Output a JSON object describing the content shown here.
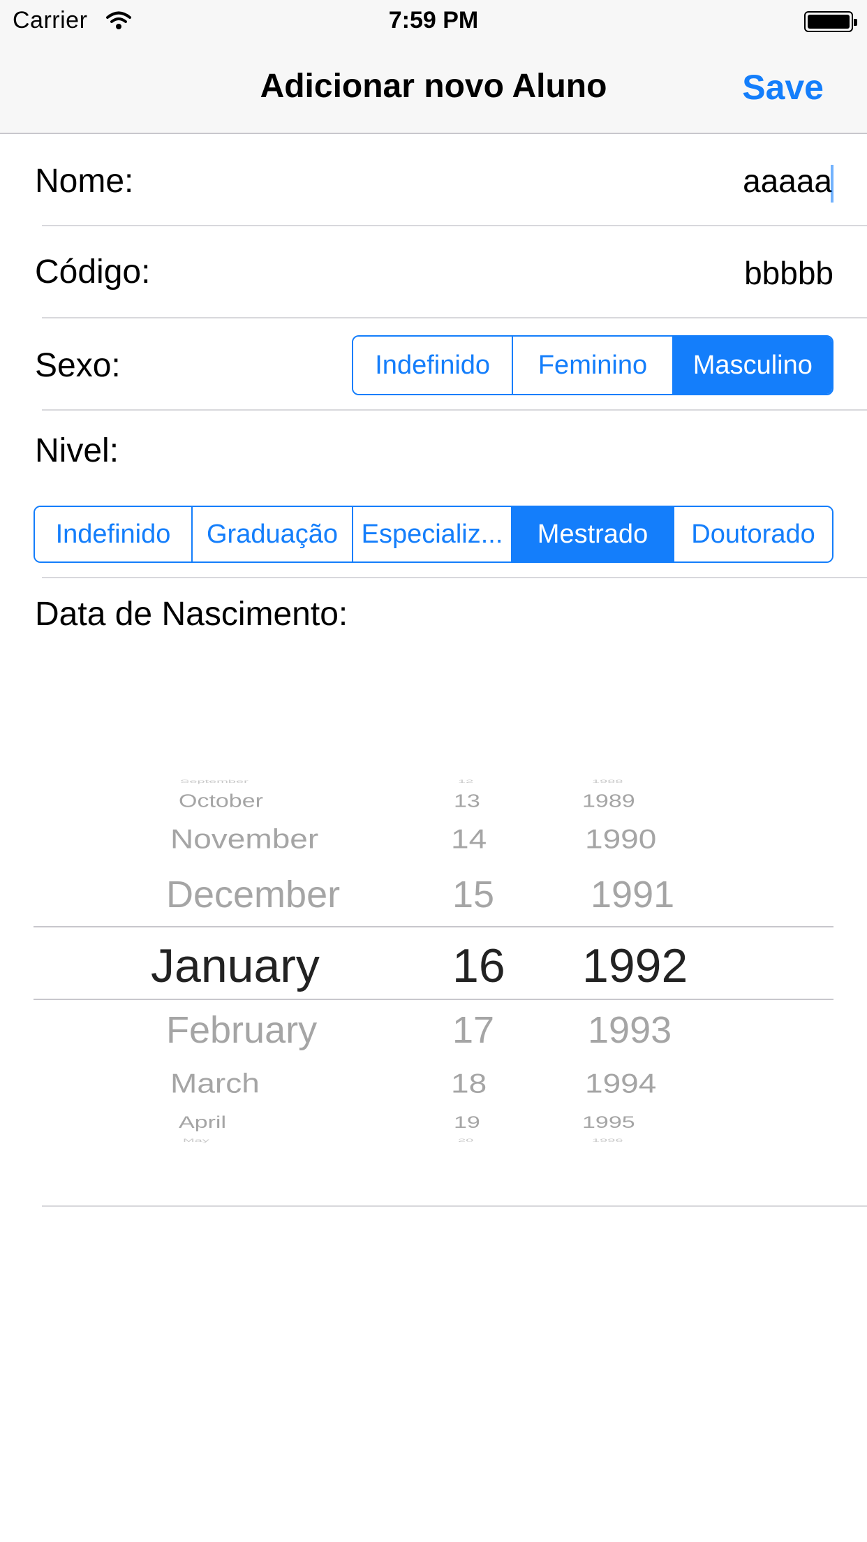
{
  "status_bar": {
    "carrier": "Carrier",
    "time": "7:59 PM"
  },
  "nav": {
    "title": "Adicionar novo Aluno",
    "save_label": "Save"
  },
  "form": {
    "nome": {
      "label": "Nome:",
      "value": "aaaaa"
    },
    "codigo": {
      "label": "Código:",
      "value": "bbbbb"
    },
    "sexo": {
      "label": "Sexo:",
      "options": [
        "Indefinido",
        "Feminino",
        "Masculino"
      ],
      "selected": "Masculino"
    },
    "nivel": {
      "label": "Nivel:",
      "options": [
        "Indefinido",
        "Graduação",
        "Especializ...",
        "Mestrado",
        "Doutorado"
      ],
      "selected": "Mestrado"
    },
    "data_nascimento": {
      "label": "Data de Nascimento:"
    }
  },
  "date_picker": {
    "months": [
      "September",
      "October",
      "November",
      "December",
      "January",
      "February",
      "March",
      "April",
      "May"
    ],
    "days": [
      "12",
      "13",
      "14",
      "15",
      "16",
      "17",
      "18",
      "19",
      "20"
    ],
    "years": [
      "1988",
      "1989",
      "1990",
      "1991",
      "1992",
      "1993",
      "1994",
      "1995",
      "1996"
    ],
    "selected": {
      "month": "January",
      "day": "16",
      "year": "1992"
    }
  },
  "colors": {
    "accent": "#147efb",
    "separator": "#d8d8dc",
    "bar_background": "#f7f7f7"
  },
  "icons": {
    "wifi": "wifi-icon",
    "battery": "battery-icon"
  }
}
